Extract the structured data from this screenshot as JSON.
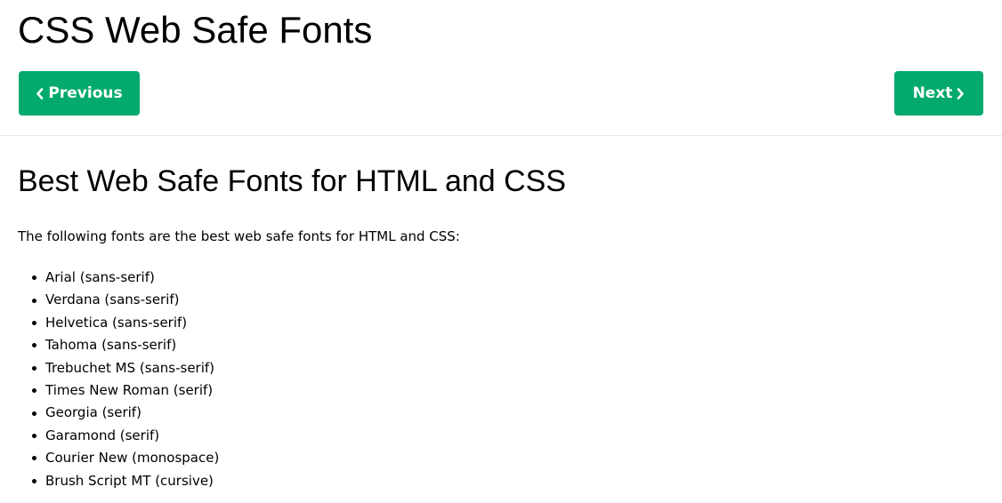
{
  "page": {
    "title": "CSS Web Safe Fonts"
  },
  "nav": {
    "previous_label": "Previous",
    "next_label": "Next",
    "button_color": "#04AA6D",
    "previous_icon": "chevron-left-icon",
    "next_icon": "chevron-right-icon"
  },
  "section": {
    "heading": "Best Web Safe Fonts for HTML and CSS",
    "intro": "The following fonts are the best web safe fonts for HTML and CSS:",
    "fonts": [
      "Arial (sans-serif)",
      "Verdana (sans-serif)",
      "Helvetica (sans-serif)",
      "Tahoma (sans-serif)",
      "Trebuchet MS (sans-serif)",
      "Times New Roman (serif)",
      "Georgia (serif)",
      "Garamond (serif)",
      "Courier New (monospace)",
      "Brush Script MT (cursive)"
    ]
  }
}
